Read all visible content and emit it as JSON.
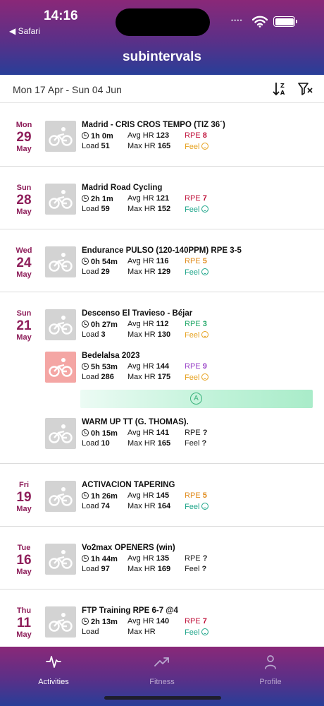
{
  "status_bar": {
    "time": "14:16",
    "back_label": "◀ Safari",
    "signal": "••••"
  },
  "header": {
    "title": "subintervals"
  },
  "toolbar": {
    "date_range": "Mon 17 Apr - Sun 04 Jun",
    "sort_icon": "sort-za-icon",
    "filter_icon": "filter-clear-icon"
  },
  "colors": {
    "accent": "#8e1e5a",
    "rpe_high": "#c0143c",
    "rpe_mid": "#e08c1e",
    "rpe_low": "#22a868",
    "rpe_purple": "#9a44c8",
    "feel_ok": "#e6a11e",
    "feel_good": "#1ea58a",
    "header_top": "#8a2878",
    "header_bottom": "#283e98"
  },
  "days": [
    {
      "dow": "Mon",
      "day": "29",
      "month": "May",
      "activities": [
        {
          "title": "Madrid - CRIS CROS TEMPO (TIZ 36´)",
          "duration": "1h 0m",
          "load_label": "Load",
          "load": "51",
          "avg_hr_label": "Avg HR",
          "avg_hr": "123",
          "max_hr_label": "Max HR",
          "max_hr": "165",
          "rpe_label": "RPE",
          "rpe": "8",
          "feel_label": "Feel",
          "rpe_color": "#c0143c",
          "feel_color": "#e6a11e",
          "highlight": false
        }
      ]
    },
    {
      "dow": "Sun",
      "day": "28",
      "month": "May",
      "activities": [
        {
          "title": "Madrid Road Cycling",
          "duration": "2h 1m",
          "load_label": "Load",
          "load": "59",
          "avg_hr_label": "Avg HR",
          "avg_hr": "121",
          "max_hr_label": "Max HR",
          "max_hr": "152",
          "rpe_label": "RPE",
          "rpe": "7",
          "feel_label": "Feel",
          "rpe_color": "#c0143c",
          "feel_color": "#1ea58a",
          "highlight": false
        }
      ]
    },
    {
      "dow": "Wed",
      "day": "24",
      "month": "May",
      "activities": [
        {
          "title": "Endurance PULSO (120-140PPM) RPE 3-5",
          "duration": "0h 54m",
          "load_label": "Load",
          "load": "29",
          "avg_hr_label": "Avg HR",
          "avg_hr": "116",
          "max_hr_label": "Max HR",
          "max_hr": "129",
          "rpe_label": "RPE",
          "rpe": "5",
          "feel_label": "Feel",
          "rpe_color": "#e08c1e",
          "feel_color": "#1ea58a",
          "highlight": false
        }
      ]
    },
    {
      "dow": "Sun",
      "day": "21",
      "month": "May",
      "activities": [
        {
          "title": "Descenso El Travieso - Béjar",
          "duration": "0h 27m",
          "load_label": "Load",
          "load": "3",
          "avg_hr_label": "Avg HR",
          "avg_hr": "112",
          "max_hr_label": "Max HR",
          "max_hr": "130",
          "rpe_label": "RPE",
          "rpe": "3",
          "feel_label": "Feel",
          "rpe_color": "#22a868",
          "feel_color": "#e6a11e",
          "highlight": false
        },
        {
          "title": "Bedelalsa 2023",
          "duration": "5h 53m",
          "load_label": "Load",
          "load": "286",
          "avg_hr_label": "Avg HR",
          "avg_hr": "144",
          "max_hr_label": "Max HR",
          "max_hr": "175",
          "rpe_label": "RPE",
          "rpe": "9",
          "feel_label": "Feel",
          "rpe_color": "#9a44c8",
          "feel_color": "#e6a11e",
          "highlight": true,
          "strip_badge": "A"
        },
        {
          "title": "WARM UP TT (G. THOMAS).",
          "duration": "0h 15m",
          "load_label": "Load",
          "load": "10",
          "avg_hr_label": "Avg HR",
          "avg_hr": "141",
          "max_hr_label": "Max HR",
          "max_hr": "165",
          "rpe_label": "RPE",
          "rpe": "?",
          "feel_label": "Feel",
          "feel_value": "?",
          "rpe_color": "#222222",
          "feel_color": "#222222",
          "highlight": false
        }
      ]
    },
    {
      "dow": "Fri",
      "day": "19",
      "month": "May",
      "activities": [
        {
          "title": "ACTIVACION TAPERING",
          "duration": "1h 26m",
          "load_label": "Load",
          "load": "74",
          "avg_hr_label": "Avg HR",
          "avg_hr": "145",
          "max_hr_label": "Max HR",
          "max_hr": "164",
          "rpe_label": "RPE",
          "rpe": "5",
          "feel_label": "Feel",
          "rpe_color": "#e08c1e",
          "feel_color": "#1ea58a",
          "highlight": false
        }
      ]
    },
    {
      "dow": "Tue",
      "day": "16",
      "month": "May",
      "activities": [
        {
          "title": "Vo2max OPENERS (win)",
          "duration": "1h 44m",
          "load_label": "Load",
          "load": "97",
          "avg_hr_label": "Avg HR",
          "avg_hr": "135",
          "max_hr_label": "Max HR",
          "max_hr": "169",
          "rpe_label": "RPE",
          "rpe": "?",
          "feel_label": "Feel",
          "feel_value": "?",
          "rpe_color": "#222222",
          "feel_color": "#222222",
          "highlight": false
        }
      ]
    },
    {
      "dow": "Thu",
      "day": "11",
      "month": "May",
      "activities": [
        {
          "title": "FTP Training RPE 6-7 @4",
          "duration": "2h 13m",
          "load_label": "Load",
          "load": "",
          "avg_hr_label": "Avg HR",
          "avg_hr": "140",
          "max_hr_label": "Max HR",
          "max_hr": "",
          "rpe_label": "RPE",
          "rpe": "7",
          "feel_label": "Feel",
          "rpe_color": "#c0143c",
          "feel_color": "#1ea58a",
          "highlight": false
        }
      ]
    }
  ],
  "tabbar": {
    "tabs": [
      {
        "label": "Activities",
        "icon": "activity-pulse-icon",
        "active": true
      },
      {
        "label": "Fitness",
        "icon": "trend-up-icon",
        "active": false
      },
      {
        "label": "Profile",
        "icon": "person-icon",
        "active": false
      }
    ]
  }
}
